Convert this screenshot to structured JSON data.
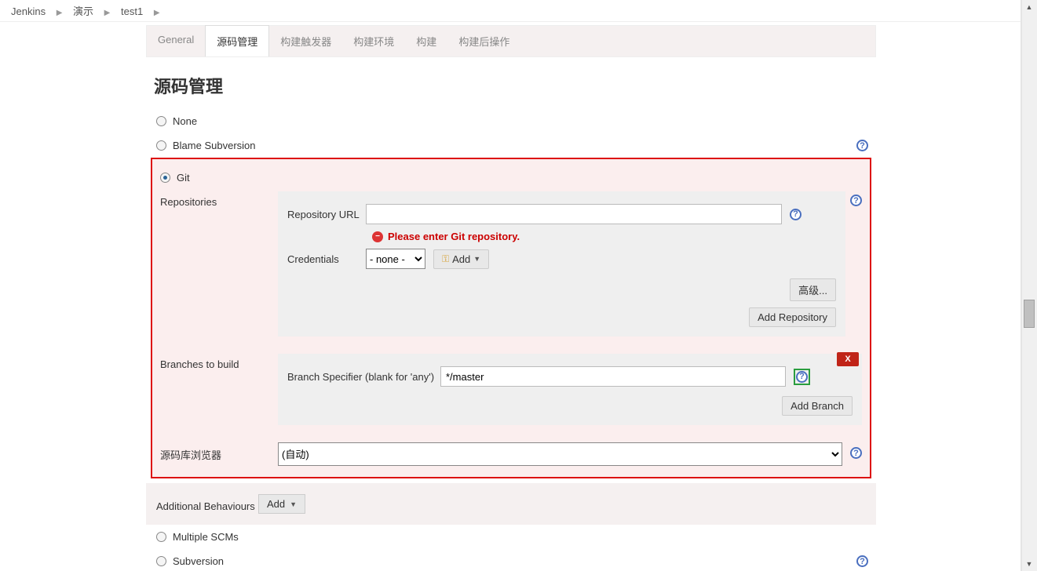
{
  "breadcrumb": {
    "b0": "Jenkins",
    "b1": "演示",
    "b2": "test1"
  },
  "tabs": {
    "general": "General",
    "scm": "源码管理",
    "triggers": "构建触发器",
    "env": "构建环境",
    "build": "构建",
    "post": "构建后操作"
  },
  "section_title": "源码管理",
  "scm_options": {
    "none": "None",
    "blame_svn": "Blame Subversion",
    "git": "Git",
    "multiple": "Multiple SCMs",
    "subversion": "Subversion"
  },
  "git": {
    "repositories_label": "Repositories",
    "repo_url_label": "Repository URL",
    "repo_url_value": "",
    "repo_error": "Please enter Git repository.",
    "credentials_label": "Credentials",
    "credentials_value": "- none -",
    "add_cred_label": "Add",
    "advanced_label": "高级...",
    "add_repo_label": "Add Repository",
    "branches_label": "Branches to build",
    "branch_specifier_label": "Branch Specifier (blank for 'any')",
    "branch_specifier_value": "*/master",
    "delete_x": "X",
    "add_branch_label": "Add Branch",
    "browser_label": "源码库浏览器",
    "browser_value": "(自动)"
  },
  "additional": {
    "label": "Additional Behaviours",
    "add_label": "Add"
  },
  "help_glyph": "?"
}
